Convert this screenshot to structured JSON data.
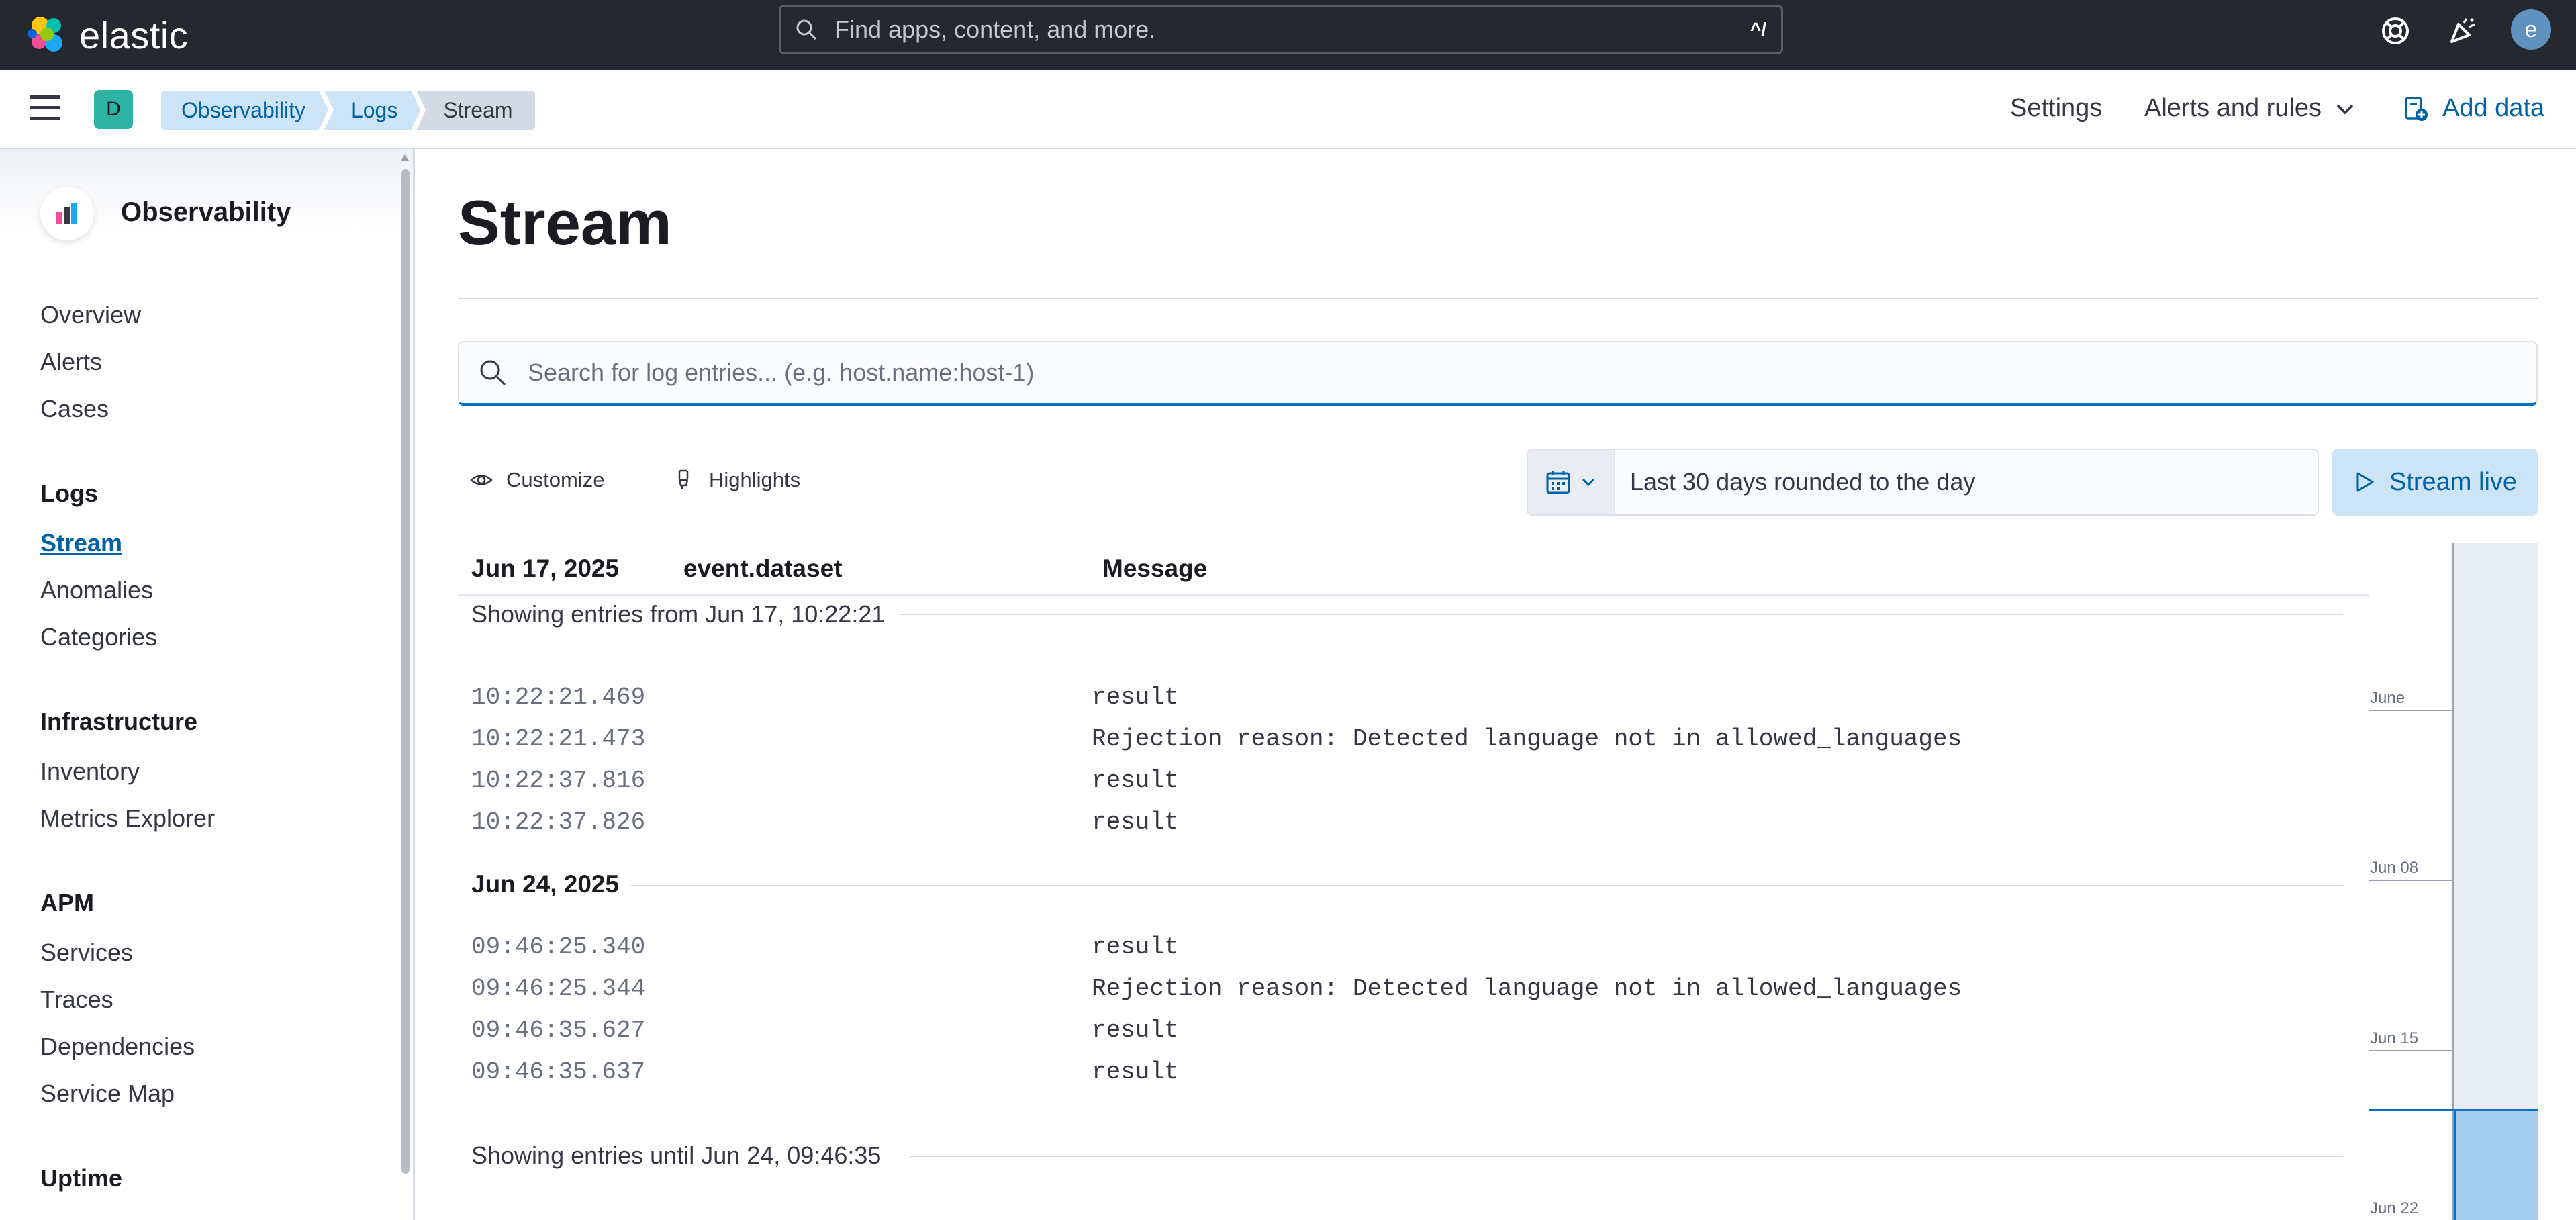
{
  "app": {
    "logo_text": "elastic",
    "search_placeholder": "Find apps, content, and more.",
    "search_shortcut": "^/",
    "user_initial": "e"
  },
  "header": {
    "space_initial": "D",
    "breadcrumbs": [
      "Observability",
      "Logs",
      "Stream"
    ],
    "settings_label": "Settings",
    "alerts_label": "Alerts and rules",
    "add_data_label": "Add data"
  },
  "sidebar": {
    "title": "Observability",
    "top_items": [
      "Overview",
      "Alerts",
      "Cases"
    ],
    "groups": [
      {
        "title": "Logs",
        "items": [
          "Stream",
          "Anomalies",
          "Categories"
        ]
      },
      {
        "title": "Infrastructure",
        "items": [
          "Inventory",
          "Metrics Explorer"
        ]
      },
      {
        "title": "APM",
        "items": [
          "Services",
          "Traces",
          "Dependencies",
          "Service Map"
        ]
      },
      {
        "title": "Uptime",
        "items": []
      }
    ],
    "active_item": "Stream"
  },
  "main": {
    "title": "Stream",
    "search_placeholder": "Search for log entries... (e.g. host.name:host-1)",
    "customize_label": "Customize",
    "highlights_label": "Highlights",
    "time_range": "Last 30 days rounded to the day",
    "stream_live_label": "Stream live",
    "columns": {
      "date": "Jun 17, 2025",
      "dataset": "event.dataset",
      "message": "Message"
    },
    "showing_from": "Showing entries from Jun 17, 10:22:21",
    "showing_until": "Showing entries until Jun 24, 09:46:35",
    "day_separator": "Jun 24, 2025",
    "entries_day1": [
      {
        "time": "10:22:21.469",
        "message": "result"
      },
      {
        "time": "10:22:21.473",
        "message": "Rejection reason: Detected language not in allowed_languages"
      },
      {
        "time": "10:22:37.816",
        "message": "result"
      },
      {
        "time": "10:22:37.826",
        "message": "result"
      }
    ],
    "entries_day2": [
      {
        "time": "09:46:25.340",
        "message": "result"
      },
      {
        "time": "09:46:25.344",
        "message": "Rejection reason: Detected language not in allowed_languages"
      },
      {
        "time": "09:46:35.627",
        "message": "result"
      },
      {
        "time": "09:46:35.637",
        "message": "result"
      }
    ],
    "minimap_labels": [
      "June",
      "Jun 08",
      "Jun 15",
      "Jun 22"
    ]
  },
  "colors": {
    "topbar_bg": "#25282f",
    "link": "#0061a6",
    "breadcrumb_link_bg": "#cce4f5",
    "space_badge": "#2cb3a3",
    "minimap_highlight": "#a5cdee"
  }
}
